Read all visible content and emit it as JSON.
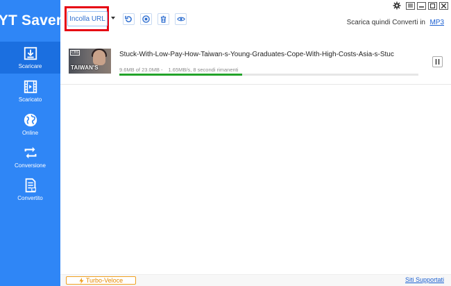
{
  "app": {
    "title": "YT Saver"
  },
  "sidebar": {
    "items": [
      {
        "label": "Scaricare",
        "icon": "download-icon",
        "active": true
      },
      {
        "label": "Scaricato",
        "icon": "film-icon",
        "active": false
      },
      {
        "label": "Online",
        "icon": "globe-icon",
        "active": false
      },
      {
        "label": "Conversione",
        "icon": "convert-icon",
        "active": false
      },
      {
        "label": "Convertito",
        "icon": "document-icon",
        "active": false
      }
    ]
  },
  "toolbar": {
    "paste_label": "Incolla URL",
    "tools": [
      "refresh-icon",
      "stop-icon",
      "trash-icon",
      "eye-icon"
    ],
    "convert_text": "Scarica quindi Converti in",
    "convert_format": "MP3"
  },
  "downloads": [
    {
      "thumbnail_logo": "CBS",
      "thumbnail_caption": "TAIWAN'S",
      "title": "Stuck-With-Low-Pay-How-Taiwan-s-Young-Graduates-Cope-With-High-Costs-Asia-s-Stuc",
      "size_progress": "9.6MB of 23.0MB -",
      "speed_eta": "1.65MB/s, 8 secondi rimanenti",
      "progress": 0.41
    }
  ],
  "footer": {
    "turbo_label": "Turbo-Veloce",
    "supported_label": "Siti Supportati"
  },
  "colors": {
    "sidebar": "#2f86f6",
    "sidebar_active": "#1b6fe0",
    "accent": "#2f6fd0",
    "highlight": "#e60012",
    "progress": "#22a32a",
    "turbo": "#e58a00"
  }
}
